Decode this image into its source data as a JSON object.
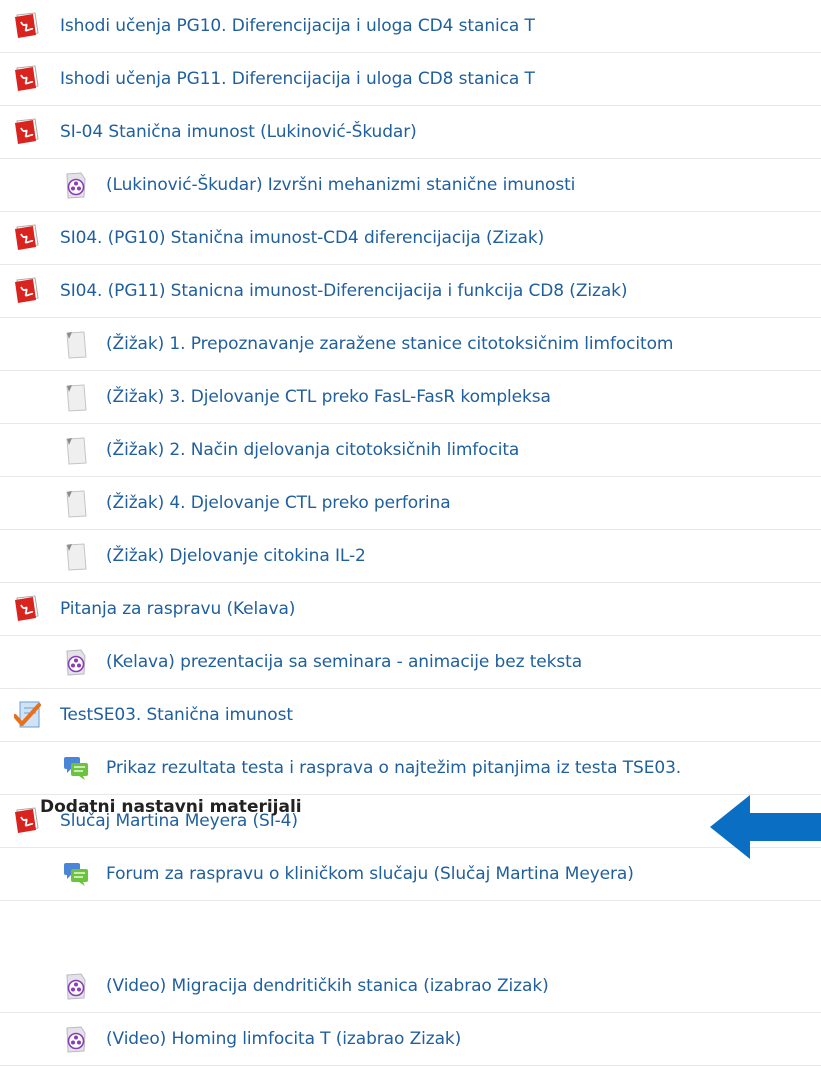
{
  "items": [
    {
      "type": "pdf",
      "indent": 0,
      "label": "Ishodi učenja PG10. Diferencijacija i uloga CD4 stanica T"
    },
    {
      "type": "pdf",
      "indent": 0,
      "label": "Ishodi učenja PG11. Diferencijacija i uloga CD8 stanica T"
    },
    {
      "type": "pdf",
      "indent": 0,
      "label": "SI-04 Stanična imunost (Lukinović-Škudar)"
    },
    {
      "type": "media",
      "indent": 1,
      "label": "(Lukinović-Škudar) Izvršni mehanizmi stanične imunosti"
    },
    {
      "type": "pdf",
      "indent": 0,
      "label": "SI04. (PG10) Stanična imunost-CD4 diferencijacija (Zizak)"
    },
    {
      "type": "pdf",
      "indent": 0,
      "label": "SI04. (PG11) Stanicna imunost-Diferencijacija i funkcija CD8 (Zizak)"
    },
    {
      "type": "file",
      "indent": 1,
      "label": "(Žižak) 1. Prepoznavanje zaražene stanice citotoksičnim limfocitom"
    },
    {
      "type": "file",
      "indent": 1,
      "label": "(Žižak) 3. Djelovanje CTL preko FasL-FasR kompleksa"
    },
    {
      "type": "file",
      "indent": 1,
      "label": "(Žižak) 2. Način djelovanja citotoksičnih limfocita"
    },
    {
      "type": "file",
      "indent": 1,
      "label": "(Žižak) 4. Djelovanje CTL preko perforina"
    },
    {
      "type": "file",
      "indent": 1,
      "label": "(Žižak) Djelovanje citokina IL-2"
    },
    {
      "type": "pdf",
      "indent": 0,
      "label": "Pitanja za raspravu (Kelava)"
    },
    {
      "type": "media",
      "indent": 1,
      "label": "(Kelava) prezentacija sa seminara - animacije bez teksta"
    },
    {
      "type": "quiz",
      "indent": 0,
      "label": "TestSE03. Stanična imunost"
    },
    {
      "type": "forum",
      "indent": 1,
      "label": "Prikaz rezultata testa i rasprava o najtežim pitanjima iz testa TSE03."
    },
    {
      "type": "pdf",
      "indent": 0,
      "label": "Slučaj Martina Meyera (SI-4)"
    },
    {
      "type": "forum",
      "indent": 1,
      "label": "Forum za raspravu o kliničkom slučaju (Slučaj Martina Meyera)"
    }
  ],
  "section_title": "Dodatni nastavni materijali",
  "extra_items": [
    {
      "type": "media",
      "indent": 1,
      "label": "(Video) Migracija dendritičkih stanica (izabrao Zizak)"
    },
    {
      "type": "media",
      "indent": 1,
      "label": "(Video) Homing limfocita T (izabrao Zizak)"
    }
  ],
  "colors": {
    "link": "#1f5f9e",
    "arrow": "#0a6fc2",
    "pdf": "#d9231f"
  }
}
